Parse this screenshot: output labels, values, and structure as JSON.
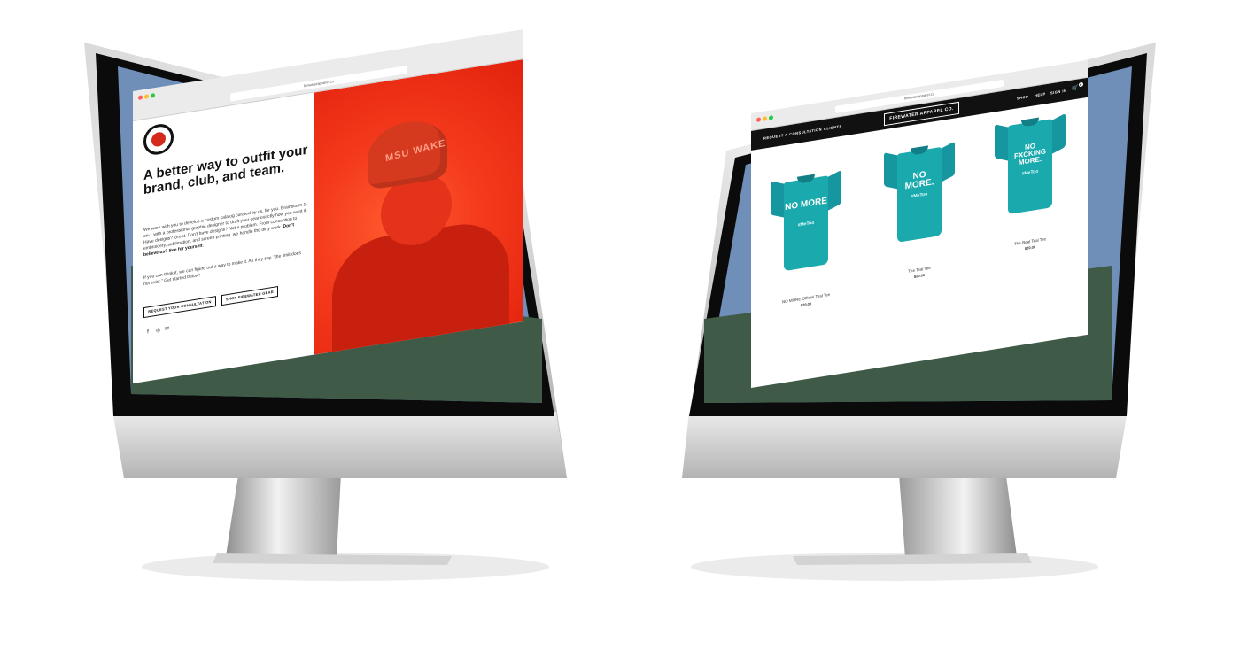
{
  "left_site": {
    "url": "firewaterapparel.co",
    "headline": "A better way to outfit your brand, club, and team.",
    "intro": "We work with you to develop a custom catalog curated by us, for you. Brainstorm 1-on-1 with a professional graphic designer to draft your gear exactly how you want it. Have designs? Great. Don't have designs? Not a problem. From conception to embroidery, sublimation, and screen printing, we handle the dirty work.",
    "intro_bold": "Don't believe us? See for yourself.",
    "para2": "If you can think it, we can figure out a way to make it. As they say, \"the limit does not exist.\" Get started below!",
    "cta_primary": "REQUEST YOUR CONSULTATION",
    "cta_secondary": "SHOP FIREWATER GEAR",
    "cap_text": "MSU WAKE",
    "social_icons": [
      "facebook-icon",
      "instagram-icon",
      "email-icon"
    ],
    "accent": "#f43a1c"
  },
  "right_site": {
    "url": "firewaterapparel.co",
    "brand": "FIREWATER APPAREL CO.",
    "nav_left": [
      "REQUEST A CONSULTATION",
      "CLIENTS"
    ],
    "nav_right": [
      "SHOP",
      "HELP",
      "SIGN IN"
    ],
    "cart_count": "0",
    "products": [
      {
        "print": "NO MORE",
        "tag": "#MeToo",
        "name": "NO MORE Official Teal Tee",
        "price": "$20.00"
      },
      {
        "print": "NO MORE.",
        "tag": "#MeToo",
        "name": "The Teal Tee",
        "price": "$20.00"
      },
      {
        "print": "NO FXCKING MORE.",
        "tag": "#MeToo",
        "name": "The Real Teal Tee",
        "price": "$20.00"
      }
    ],
    "accent": "#1aa9ac"
  }
}
